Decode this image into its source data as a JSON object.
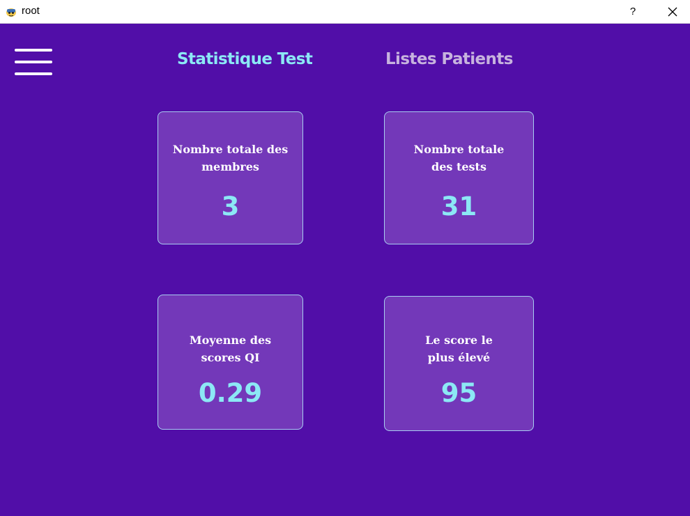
{
  "window": {
    "title": "root",
    "help_label": "?",
    "app_icon": "python-feather-icon",
    "close_icon": "close-icon"
  },
  "nav": {
    "menu_icon": "hamburger-menu-icon",
    "tabs": [
      {
        "label": "Statistique Test",
        "active": true
      },
      {
        "label": "Listes Patients",
        "active": false
      }
    ]
  },
  "cards": [
    {
      "label": "Nombre totale des\nmembres",
      "value": "3"
    },
    {
      "label": "Nombre totale\ndes tests",
      "value": "31"
    },
    {
      "label": "Moyenne des\nscores QI",
      "value": "0.29"
    },
    {
      "label": "Le score le\nplus élevé",
      "value": "95"
    }
  ],
  "colors": {
    "background": "#510ea8",
    "card_background": "#7338b9",
    "card_border": "#a8cdf0",
    "accent": "#8ce8f5",
    "inactive_tab": "#c7b3de",
    "label_text": "#ffffff"
  }
}
